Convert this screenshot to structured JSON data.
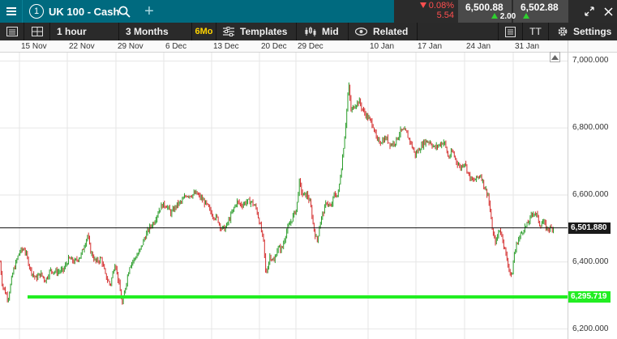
{
  "header": {
    "tab_number": "1",
    "instrument": "UK 100 - Cash",
    "change_pct": "0.08%",
    "change_pts": "5.54",
    "sell_price": "6,500.88",
    "buy_price": "6,502.88",
    "spread": "2.00"
  },
  "toolbar": {
    "interval": "1 hour",
    "range": "3 Months",
    "range_short": "6Mo",
    "templates_label": "Templates",
    "price_type": "Mid",
    "related_label": "Related",
    "settings_label": "Settings",
    "text_tool_label": "TT"
  },
  "icons": [
    "menu-icon",
    "search-icon",
    "plus-icon",
    "change-down-icon",
    "spread-up-icon",
    "expand-icon",
    "close-icon",
    "panel-icon",
    "layout-grid-icon",
    "templates-icon",
    "candlestick-icon",
    "related-eye-icon",
    "list-icon",
    "text-tool-icon",
    "gear-icon",
    "home-icon"
  ],
  "colors": {
    "header_bg": "#006a7f",
    "toolbar_bg": "#2a2a2a",
    "up_candle": "#2a9d2a",
    "down_candle": "#d42c2c",
    "support_line": "#22ee22",
    "price_line": "#111111",
    "negative_change": "#ff4f4f"
  },
  "chart_data": {
    "type": "candlestick",
    "x_ticks": [
      "15 Nov",
      "22 Nov",
      "29 Nov",
      "6 Dec",
      "13 Dec",
      "20 Dec",
      "29 Dec",
      "10 Jan",
      "17 Jan",
      "24 Jan",
      "31 Jan"
    ],
    "y_ticks": [
      "7,000.000",
      "6,800.000",
      "6,600.000",
      "6,400.000",
      "6,200.000"
    ],
    "y_tick_values": [
      7000,
      6800,
      6600,
      6400,
      6200
    ],
    "ylim": [
      6170,
      7025
    ],
    "current_price": {
      "label": "6,501.880",
      "value": 6501.88
    },
    "support_level": {
      "label": "6,295.719",
      "value": 6295.719
    },
    "grid": true,
    "series_path": [
      [
        0,
        6400
      ],
      [
        3,
        6330
      ],
      [
        10,
        6290
      ],
      [
        16,
        6370
      ],
      [
        24,
        6430
      ],
      [
        30,
        6440
      ],
      [
        38,
        6375
      ],
      [
        44,
        6350
      ],
      [
        50,
        6365
      ],
      [
        56,
        6345
      ],
      [
        62,
        6375
      ],
      [
        70,
        6370
      ],
      [
        78,
        6375
      ],
      [
        85,
        6410
      ],
      [
        92,
        6400
      ],
      [
        100,
        6420
      ],
      [
        108,
        6480
      ],
      [
        112,
        6430
      ],
      [
        118,
        6400
      ],
      [
        125,
        6410
      ],
      [
        130,
        6360
      ],
      [
        136,
        6330
      ],
      [
        142,
        6400
      ],
      [
        147,
        6330
      ],
      [
        151,
        6270
      ],
      [
        155,
        6330
      ],
      [
        160,
        6390
      ],
      [
        166,
        6410
      ],
      [
        172,
        6430
      ],
      [
        178,
        6470
      ],
      [
        184,
        6500
      ],
      [
        190,
        6520
      ],
      [
        196,
        6555
      ],
      [
        200,
        6570
      ],
      [
        205,
        6570
      ],
      [
        211,
        6545
      ],
      [
        218,
        6570
      ],
      [
        224,
        6580
      ],
      [
        230,
        6600
      ],
      [
        236,
        6600
      ],
      [
        242,
        6605
      ],
      [
        248,
        6590
      ],
      [
        255,
        6570
      ],
      [
        262,
        6540
      ],
      [
        268,
        6530
      ],
      [
        273,
        6500
      ],
      [
        278,
        6500
      ],
      [
        285,
        6540
      ],
      [
        292,
        6580
      ],
      [
        298,
        6570
      ],
      [
        304,
        6580
      ],
      [
        310,
        6580
      ],
      [
        316,
        6560
      ],
      [
        320,
        6520
      ],
      [
        325,
        6460
      ],
      [
        328,
        6360
      ],
      [
        333,
        6420
      ],
      [
        338,
        6400
      ],
      [
        342,
        6440
      ],
      [
        348,
        6440
      ],
      [
        353,
        6490
      ],
      [
        357,
        6510
      ],
      [
        362,
        6540
      ],
      [
        366,
        6560
      ],
      [
        369,
        6640
      ],
      [
        373,
        6600
      ],
      [
        379,
        6600
      ],
      [
        383,
        6570
      ],
      [
        387,
        6500
      ],
      [
        391,
        6460
      ],
      [
        395,
        6520
      ],
      [
        399,
        6550
      ],
      [
        403,
        6580
      ],
      [
        408,
        6560
      ],
      [
        412,
        6600
      ],
      [
        417,
        6600
      ],
      [
        422,
        6700
      ],
      [
        426,
        6800
      ],
      [
        430,
        6930
      ],
      [
        433,
        6850
      ],
      [
        438,
        6870
      ],
      [
        443,
        6880
      ],
      [
        448,
        6850
      ],
      [
        454,
        6830
      ],
      [
        460,
        6810
      ],
      [
        465,
        6760
      ],
      [
        470,
        6760
      ],
      [
        476,
        6770
      ],
      [
        482,
        6750
      ],
      [
        488,
        6760
      ],
      [
        494,
        6790
      ],
      [
        500,
        6790
      ],
      [
        506,
        6760
      ],
      [
        512,
        6720
      ],
      [
        518,
        6740
      ],
      [
        524,
        6760
      ],
      [
        530,
        6760
      ],
      [
        536,
        6740
      ],
      [
        542,
        6750
      ],
      [
        548,
        6760
      ],
      [
        553,
        6710
      ],
      [
        558,
        6730
      ],
      [
        563,
        6700
      ],
      [
        568,
        6680
      ],
      [
        573,
        6700
      ],
      [
        578,
        6660
      ],
      [
        583,
        6640
      ],
      [
        588,
        6650
      ],
      [
        593,
        6660
      ],
      [
        598,
        6620
      ],
      [
        602,
        6600
      ],
      [
        606,
        6520
      ],
      [
        609,
        6470
      ],
      [
        612,
        6460
      ],
      [
        616,
        6500
      ],
      [
        620,
        6470
      ],
      [
        624,
        6420
      ],
      [
        628,
        6380
      ],
      [
        631,
        6350
      ],
      [
        634,
        6420
      ],
      [
        638,
        6460
      ],
      [
        642,
        6480
      ],
      [
        646,
        6500
      ],
      [
        650,
        6510
      ],
      [
        654,
        6530
      ],
      [
        658,
        6550
      ],
      [
        662,
        6540
      ],
      [
        666,
        6510
      ],
      [
        670,
        6520
      ],
      [
        674,
        6500
      ],
      [
        680,
        6500
      ],
      [
        683,
        6505
      ]
    ]
  }
}
